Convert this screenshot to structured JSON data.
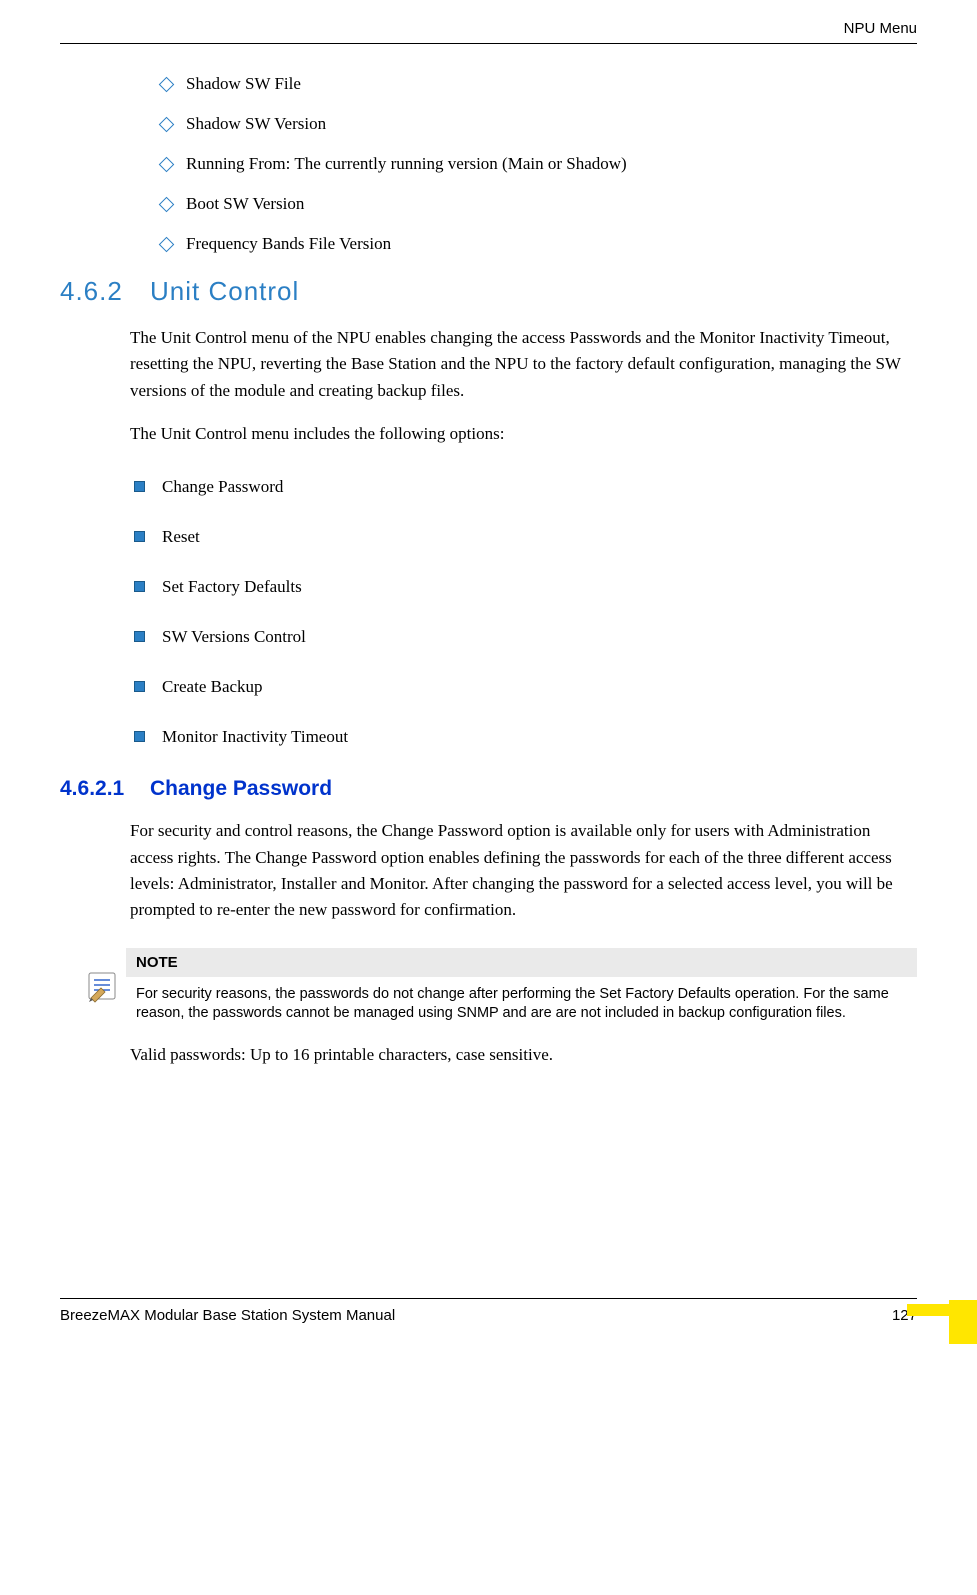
{
  "header": {
    "title": "NPU Menu"
  },
  "diamond_items": {
    "0": "Shadow SW File",
    "1": "Shadow SW Version",
    "2": "Running From: The currently running version (Main or Shadow)",
    "3": "Boot SW Version",
    "4": "Frequency Bands File Version"
  },
  "section_462": {
    "num": "4.6.2",
    "title": "Unit Control",
    "para1": "The Unit Control menu of the NPU enables changing the access Passwords and the Monitor Inactivity Timeout, resetting the NPU, reverting the Base Station and the NPU to the factory default configuration, managing the SW versions of the module and creating backup files.",
    "para2": "The Unit Control menu includes the following options:"
  },
  "square_items": {
    "0": "Change Password",
    "1": "Reset",
    "2": "Set Factory Defaults",
    "3": "SW Versions Control",
    "4": "Create Backup",
    "5": "Monitor Inactivity Timeout"
  },
  "section_4621": {
    "num": "4.6.2.1",
    "title": "Change Password",
    "para1": "For security and control reasons, the Change Password option is available only for users with Administration access rights. The Change Password option enables defining the passwords for each of the three different access levels: Administrator, Installer and Monitor. After changing the password for a selected access level, you will be prompted to re-enter the new password for confirmation."
  },
  "note": {
    "label": "NOTE",
    "text": "For security reasons, the passwords do not change after performing the Set Factory Defaults operation. For the same reason, the passwords cannot be managed using SNMP and are are not included in backup configuration files."
  },
  "valid_passwords": "Valid passwords: Up to 16 printable characters, case sensitive.",
  "footer": {
    "manual": "BreezeMAX Modular Base Station System Manual",
    "page": "127"
  }
}
